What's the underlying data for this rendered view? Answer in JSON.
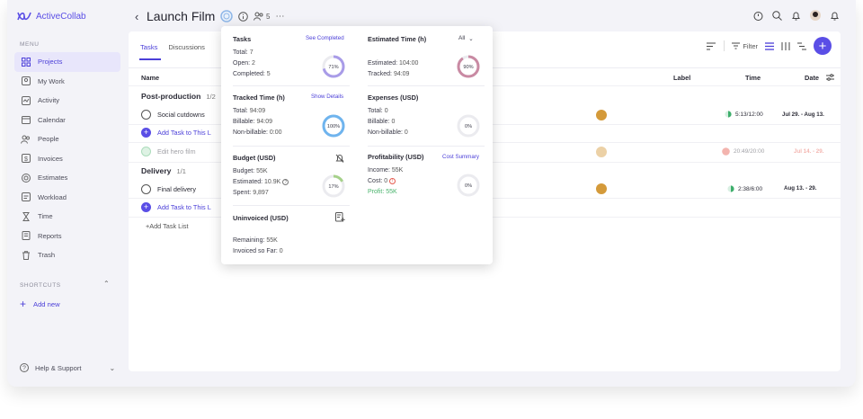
{
  "app": {
    "name": "ActiveCollab"
  },
  "sidebar": {
    "menu_label": "MENU",
    "items": [
      {
        "label": "Projects",
        "icon": "grid-icon"
      },
      {
        "label": "My Work",
        "icon": "user-card-icon"
      },
      {
        "label": "Activity",
        "icon": "activity-icon"
      },
      {
        "label": "Calendar",
        "icon": "calendar-icon"
      },
      {
        "label": "People",
        "icon": "people-icon"
      },
      {
        "label": "Invoices",
        "icon": "dollar-icon"
      },
      {
        "label": "Estimates",
        "icon": "target-icon"
      },
      {
        "label": "Workload",
        "icon": "workload-icon"
      },
      {
        "label": "Time",
        "icon": "hourglass-icon"
      },
      {
        "label": "Reports",
        "icon": "report-icon"
      },
      {
        "label": "Trash",
        "icon": "trash-icon"
      }
    ],
    "shortcuts_label": "SHORTCUTS",
    "add_new": "Add new",
    "help": "Help & Support"
  },
  "header": {
    "title": "Launch Film",
    "people_count": "5"
  },
  "tabs": [
    "Tasks",
    "Discussions"
  ],
  "toolbar": {
    "filter": "Filter"
  },
  "columns": {
    "name": "Name",
    "label": "Label",
    "time": "Time",
    "date": "Date"
  },
  "task_lists": [
    {
      "title": "Post-production",
      "count": "1/2"
    },
    {
      "title": "Delivery",
      "count": "1/1"
    }
  ],
  "tasks": [
    {
      "name": "Social cutdowns",
      "time": "5:13/12:00",
      "date": "Jul 29. - Aug 13."
    },
    {
      "name": "Edit hero film",
      "time": "20:49/20:00",
      "date": "Jul 14. - 29."
    },
    {
      "name": "Final delivery",
      "time": "2:38/6:00",
      "date": "Aug 13. - 29."
    }
  ],
  "add_task_label": "Add Task to This L",
  "add_task_list": "+Add Task List",
  "popup": {
    "tasks": {
      "title": "Tasks",
      "link": "See Completed",
      "total_label": "Total:",
      "total": "7",
      "open_label": "Open:",
      "open": "2",
      "completed_label": "Completed:",
      "completed": "5",
      "percent": 71,
      "percent_text": "71%"
    },
    "estimated": {
      "title": "Estimated Time (h)",
      "filter": "All",
      "estimated_label": "Estimated:",
      "estimated": "104:00",
      "tracked_label": "Tracked:",
      "tracked": "94:09",
      "percent": 90,
      "percent_text": "90%"
    },
    "tracked": {
      "title": "Tracked Time (h)",
      "link": "Show Details",
      "total_label": "Total:",
      "total": "94:09",
      "billable_label": "Billable:",
      "billable": "94:09",
      "nonbillable_label": "Non-billable:",
      "nonbillable": "0:00",
      "percent": 100,
      "percent_text": "100%"
    },
    "expenses": {
      "title": "Expenses (USD)",
      "total_label": "Total:",
      "total": "0",
      "billable_label": "Billable:",
      "billable": "0",
      "nonbillable_label": "Non-billable:",
      "nonbillable": "0",
      "percent": 0,
      "percent_text": "0%"
    },
    "budget": {
      "title": "Budget (USD)",
      "budget_label": "Budget:",
      "budget": "55K",
      "estimated_label": "Estimated:",
      "estimated": "10.9K",
      "spent_label": "Spent:",
      "spent": "9,897",
      "percent": 17,
      "percent_text": "17%"
    },
    "profitability": {
      "title": "Profitability (USD)",
      "link": "Cost Summary",
      "income_label": "Income:",
      "income": "55K",
      "cost_label": "Cost:",
      "cost": "0",
      "profit_label": "Profit:",
      "profit": "55K",
      "percent": 0,
      "percent_text": "0%"
    },
    "uninvoiced": {
      "title": "Uninvoiced (USD)",
      "remaining_label": "Remaining:",
      "remaining": "55K",
      "invoiced_label": "Invoiced so Far:",
      "invoiced": "0"
    }
  }
}
